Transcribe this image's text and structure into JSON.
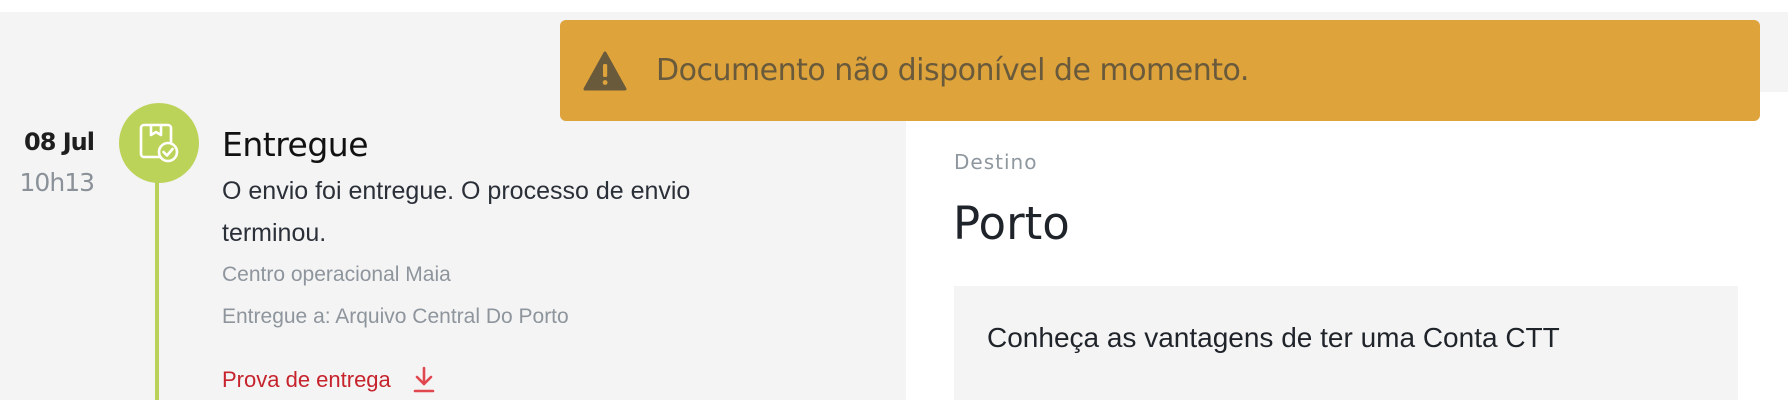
{
  "toast": {
    "message": "Documento não disponível de momento.",
    "icon": "warning-icon",
    "color": "#dea33a"
  },
  "event": {
    "date": "08 Jul",
    "time": "10h13",
    "icon": "delivered-box-icon",
    "title": "Entregue",
    "description": "O envio foi entregue. O processo de envio terminou.",
    "location": "Centro operacional Maia",
    "delivered_to": "Entregue a: Arquivo Central Do Porto",
    "proof_label": "Prova de entrega",
    "proof_icon": "download-icon",
    "accent_color": "#bcd35a"
  },
  "destination": {
    "label": "Destino",
    "city": "Porto"
  },
  "promo": {
    "text": "Conheça as vantagens de ter uma Conta CTT"
  }
}
